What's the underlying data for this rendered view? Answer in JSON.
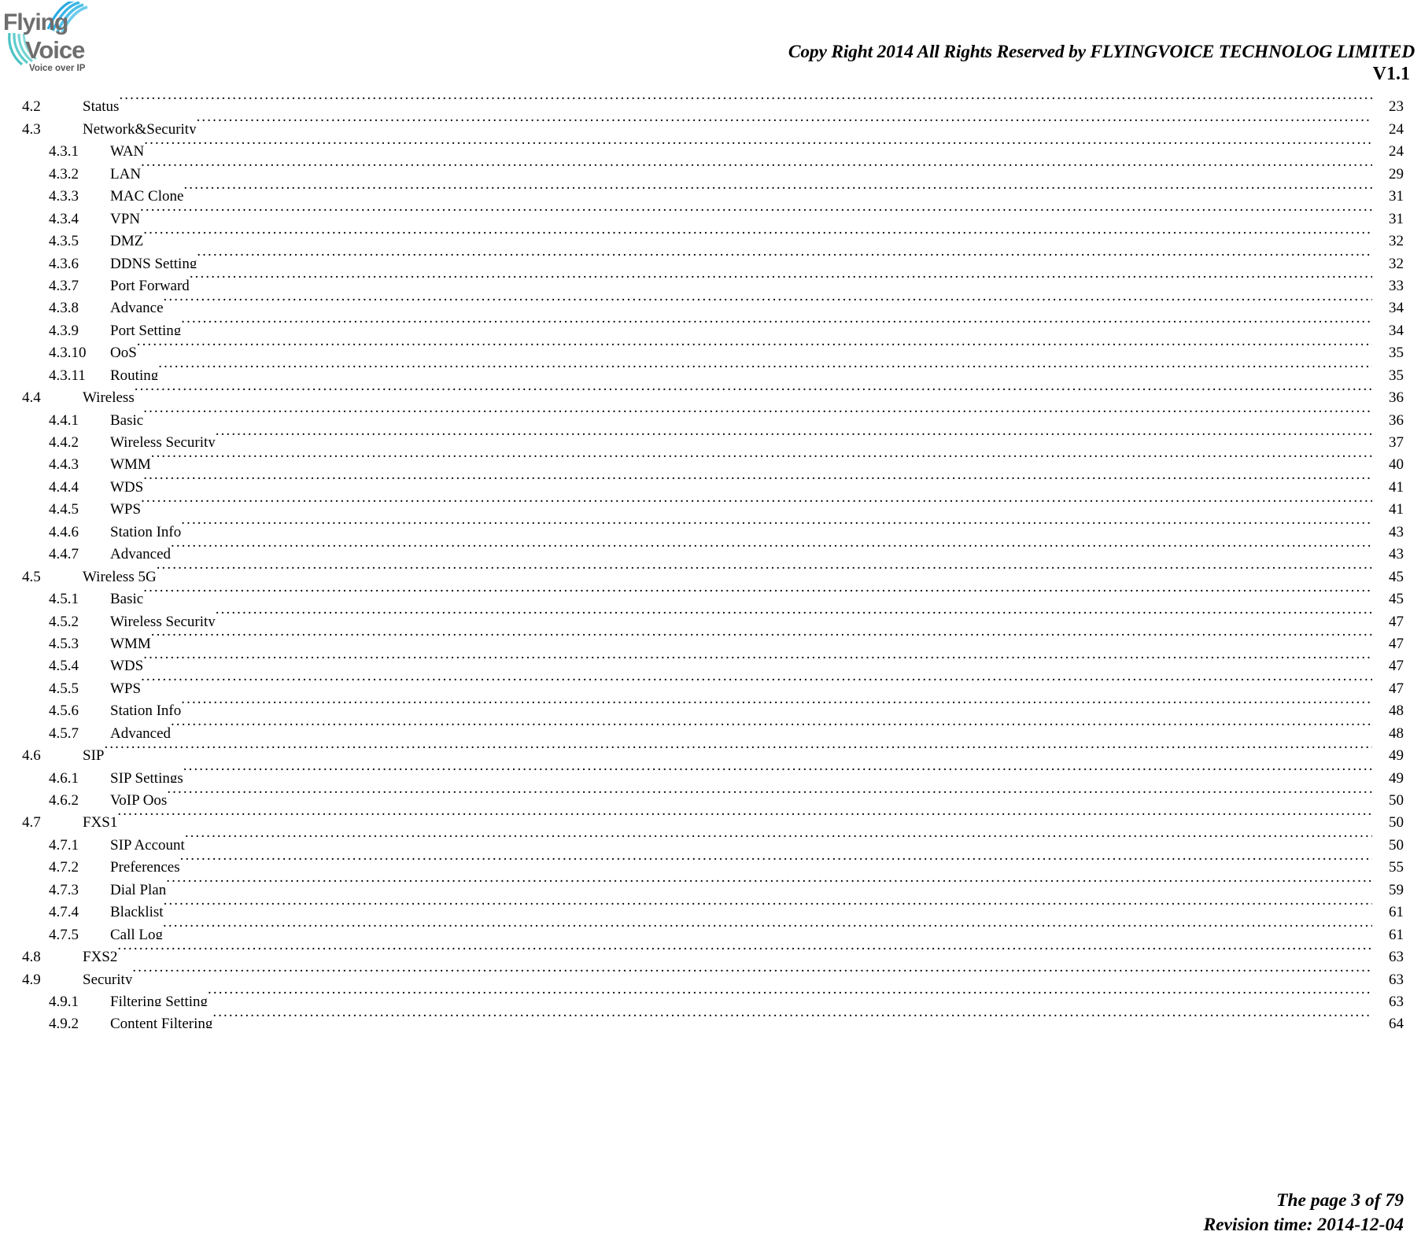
{
  "header": {
    "logo": {
      "word_top": "Flying",
      "word_bottom": "Voice",
      "tagline": "Voice over IP",
      "text_color": "#6e6e6e",
      "arc_color_top": "#29a9e0",
      "arc_color_bottom": "#4cc3c3"
    },
    "copyright": "Copy Right 2014 All Rights Reserved by FLYINGVOICE TECHNOLOG LIMITED",
    "version": "V1.1"
  },
  "toc": {
    "entries": [
      {
        "number": "4.2",
        "label": "Status",
        "page": "23",
        "level": 2
      },
      {
        "number": "4.3",
        "label": "Network&Security",
        "page": "24",
        "level": 2
      },
      {
        "number": "4.3.1",
        "label": "WAN",
        "page": "24",
        "level": 3
      },
      {
        "number": "4.3.2",
        "label": "LAN",
        "page": "29",
        "level": 3
      },
      {
        "number": "4.3.3",
        "label": "MAC Clone",
        "page": "31",
        "level": 3
      },
      {
        "number": "4.3.4",
        "label": "VPN",
        "page": "31",
        "level": 3
      },
      {
        "number": "4.3.5",
        "label": "DMZ",
        "page": "32",
        "level": 3
      },
      {
        "number": "4.3.6",
        "label": "DDNS Setting",
        "page": "32",
        "level": 3
      },
      {
        "number": "4.3.7",
        "label": "Port Forward",
        "page": "33",
        "level": 3
      },
      {
        "number": "4.3.8",
        "label": "Advance",
        "page": "34",
        "level": 3
      },
      {
        "number": "4.3.9",
        "label": "Port Setting",
        "page": "34",
        "level": 3
      },
      {
        "number": "4.3.10",
        "label": "QoS",
        "page": "35",
        "level": 3
      },
      {
        "number": "4.3.11",
        "label": "Routing",
        "page": "35",
        "level": 3
      },
      {
        "number": "4.4",
        "label": "Wireless",
        "page": "36",
        "level": 2
      },
      {
        "number": "4.4.1",
        "label": "Basic",
        "page": "36",
        "level": 3
      },
      {
        "number": "4.4.2",
        "label": "Wireless Security",
        "page": "37",
        "level": 3
      },
      {
        "number": "4.4.3",
        "label": "WMM",
        "page": "40",
        "level": 3
      },
      {
        "number": "4.4.4",
        "label": "WDS",
        "page": "41",
        "level": 3
      },
      {
        "number": "4.4.5",
        "label": "WPS",
        "page": "41",
        "level": 3
      },
      {
        "number": "4.4.6",
        "label": "Station Info",
        "page": "43",
        "level": 3
      },
      {
        "number": "4.4.7",
        "label": "Advanced",
        "page": "43",
        "level": 3
      },
      {
        "number": "4.5",
        "label": "Wireless 5G",
        "page": "45",
        "level": 2
      },
      {
        "number": "4.5.1",
        "label": "Basic",
        "page": "45",
        "level": 3
      },
      {
        "number": "4.5.2",
        "label": "Wireless Security",
        "page": "47",
        "level": 3
      },
      {
        "number": "4.5.3",
        "label": "WMM",
        "page": "47",
        "level": 3
      },
      {
        "number": "4.5.4",
        "label": "WDS",
        "page": "47",
        "level": 3
      },
      {
        "number": "4.5.5",
        "label": "WPS",
        "page": "47",
        "level": 3
      },
      {
        "number": "4.5.6",
        "label": "Station Info",
        "page": "48",
        "level": 3
      },
      {
        "number": "4.5.7",
        "label": "Advanced",
        "page": "48",
        "level": 3
      },
      {
        "number": "4.6",
        "label": "SIP",
        "page": "49",
        "level": 2
      },
      {
        "number": "4.6.1",
        "label": "SIP Settings",
        "page": "49",
        "level": 3
      },
      {
        "number": "4.6.2",
        "label": "VoIP Qos",
        "page": "50",
        "level": 3
      },
      {
        "number": "4.7",
        "label": "FXS1",
        "page": "50",
        "level": 2
      },
      {
        "number": "4.7.1",
        "label": "SIP Account",
        "page": "50",
        "level": 3
      },
      {
        "number": "4.7.2",
        "label": "Preferences",
        "page": "55",
        "level": 3
      },
      {
        "number": "4.7.3",
        "label": "Dial Plan",
        "page": "59",
        "level": 3
      },
      {
        "number": "4.7.4",
        "label": "Blacklist",
        "page": "61",
        "level": 3
      },
      {
        "number": "4.7.5",
        "label": "Call Log",
        "page": "61",
        "level": 3
      },
      {
        "number": "4.8",
        "label": "FXS2",
        "page": "63",
        "level": 2
      },
      {
        "number": "4.9",
        "label": "Security",
        "page": "63",
        "level": 2
      },
      {
        "number": "4.9.1",
        "label": "Filtering Setting",
        "page": "63",
        "level": 3
      },
      {
        "number": "4.9.2",
        "label": "Content Filtering",
        "page": "64",
        "level": 3
      }
    ]
  },
  "footer": {
    "page_info": "The page 3 of 79",
    "revision": "Revision time: 2014-12-04"
  }
}
